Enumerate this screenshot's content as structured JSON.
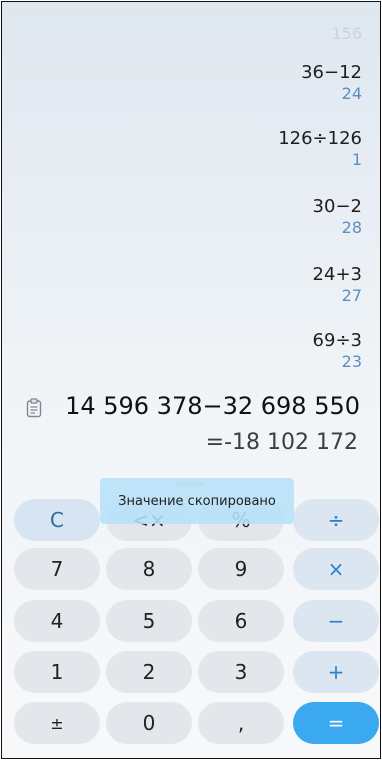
{
  "history": {
    "top_partial": "156",
    "items": [
      {
        "expr": "36−12",
        "res": "24"
      },
      {
        "expr": "126÷126",
        "res": "1"
      },
      {
        "expr": "30−2",
        "res": "28"
      },
      {
        "expr": "24+3",
        "res": "27"
      },
      {
        "expr": "69÷3",
        "res": "23"
      }
    ]
  },
  "display": {
    "expression": "14 596 378−32 698 550",
    "result": "=-18 102 172",
    "clipboard_icon": "clipboard-icon"
  },
  "toast": {
    "text": "Значение скопировано"
  },
  "keys": {
    "clear": "C",
    "backspace": "<×",
    "percent": "%",
    "divide": "÷",
    "seven": "7",
    "eight": "8",
    "nine": "9",
    "multiply": "×",
    "four": "4",
    "five": "5",
    "six": "6",
    "minus": "−",
    "one": "1",
    "two": "2",
    "three": "3",
    "plus": "+",
    "plusminus": "±",
    "zero": "0",
    "comma": ",",
    "equals": "="
  },
  "colors": {
    "accent": "#3aa9f0",
    "operator": "#2d7fca",
    "result_history": "#5a8fc0"
  }
}
